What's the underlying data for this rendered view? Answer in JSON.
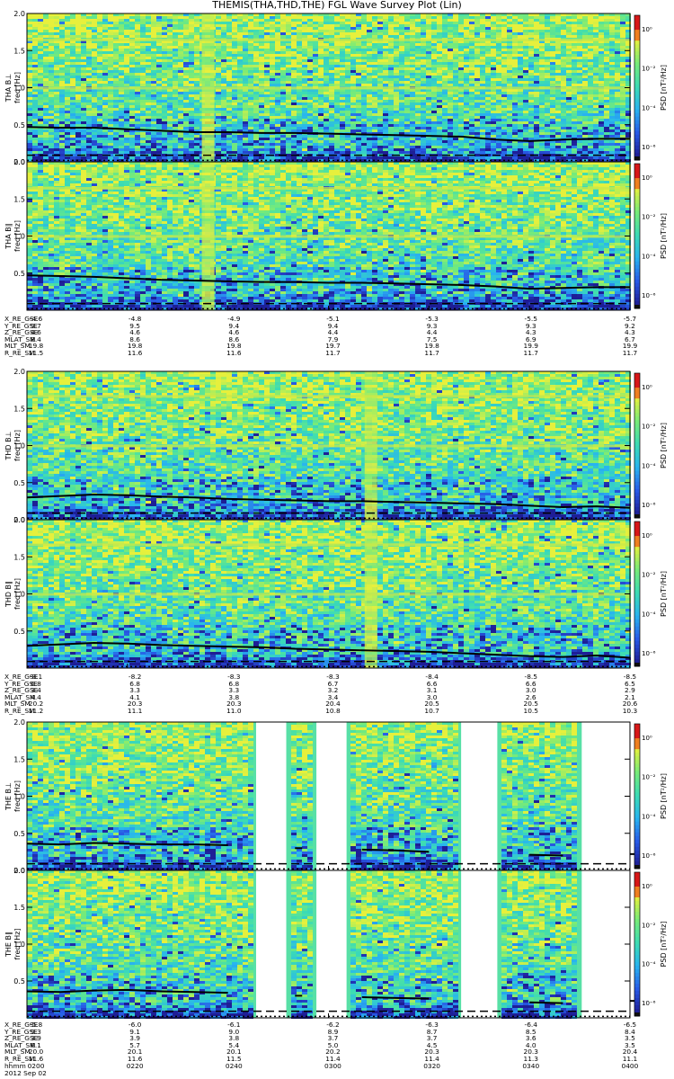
{
  "title": "THEMIS(THA,THD,THE) FGL Wave Survey Plot (Lin)",
  "date_label": "2012 Sep 02",
  "colors": {
    "background_spec": "#4fe0a0",
    "harmonic_line": "#c8e84a",
    "black_curve": "#000000"
  },
  "colorbar": {
    "label": "PSD [nT²/Hz]",
    "ticks": [
      "10⁰",
      "10⁻²",
      "10⁻⁴",
      "10⁻⁶"
    ]
  },
  "chart_data": [
    {
      "type": "heatmap",
      "probe": "THA",
      "panel": "B⊥",
      "ylabel_top": "THA B⊥",
      "ylabel": "freq [Hz]",
      "yticks": [
        "0.0",
        "0.5",
        "1.0",
        "1.5",
        "2.0"
      ],
      "ylim": [
        0,
        2.0
      ],
      "gaps": [],
      "bright_stripes": [
        0.29
      ],
      "harmonics": [
        1.0,
        1.65
      ],
      "curve": [
        0.47,
        0.46,
        0.46,
        0.44,
        0.42,
        0.4,
        0.4,
        0.39,
        0.39,
        0.38,
        0.37,
        0.36,
        0.35,
        0.34,
        0.3,
        0.28,
        0.3,
        0.31,
        0.31
      ]
    },
    {
      "type": "heatmap",
      "probe": "THA",
      "panel": "B∥",
      "ylabel_top": "THA B∥",
      "ylabel": "freq [Hz]",
      "yticks": [
        "0.5",
        "1.0",
        "1.5",
        "2.0"
      ],
      "ylim": [
        0,
        2.0
      ],
      "gaps": [],
      "bright_stripes": [
        0.29
      ],
      "harmonics": [
        1.0,
        1.65
      ],
      "curve": [
        0.47,
        0.46,
        0.45,
        0.43,
        0.41,
        0.4,
        0.39,
        0.38,
        0.38,
        0.37,
        0.37,
        0.36,
        0.35,
        0.34,
        0.32,
        0.29,
        0.3,
        0.31,
        0.31
      ]
    },
    {
      "type": "heatmap",
      "probe": "THD",
      "panel": "B⊥",
      "ylabel_top": "THD B⊥",
      "ylabel": "freq [Hz]",
      "yticks": [
        "0.0",
        "0.5",
        "1.0",
        "1.5",
        "2.0"
      ],
      "ylim": [
        0,
        2.0
      ],
      "gaps": [],
      "bright_stripes": [
        0.56
      ],
      "harmonics": [
        1.0,
        1.67
      ],
      "curve": [
        0.3,
        0.32,
        0.34,
        0.33,
        0.31,
        0.3,
        0.28,
        0.27,
        0.26,
        0.25,
        0.25,
        0.24,
        0.23,
        0.22,
        0.21,
        0.19,
        0.17,
        0.18,
        0.16
      ]
    },
    {
      "type": "heatmap",
      "probe": "THD",
      "panel": "B∥",
      "ylabel_top": "THD B∥",
      "ylabel": "freq [Hz]",
      "yticks": [
        "0.5",
        "1.0",
        "1.5",
        "2.0"
      ],
      "ylim": [
        0,
        2.0
      ],
      "gaps": [],
      "bright_stripes": [
        0.56
      ],
      "harmonics": [
        1.0,
        1.67
      ],
      "curve": [
        0.3,
        0.32,
        0.34,
        0.33,
        0.31,
        0.3,
        0.29,
        0.28,
        0.26,
        0.25,
        0.24,
        0.23,
        0.22,
        0.2,
        0.18,
        0.16,
        0.15,
        0.17,
        0.14
      ]
    },
    {
      "type": "heatmap",
      "probe": "THE",
      "panel": "B⊥",
      "ylabel_top": "THE B⊥",
      "ylabel": "freq [Hz]",
      "yticks": [
        "0.0",
        "0.5",
        "1.0",
        "1.5",
        "2.0"
      ],
      "ylim": [
        0,
        2.0
      ],
      "gaps": [
        [
          0.38,
          0.43
        ],
        [
          0.48,
          0.53
        ],
        [
          0.72,
          0.78
        ],
        [
          0.92,
          1.0
        ]
      ],
      "bright_stripes": [],
      "harmonics": [],
      "curve": [
        0.36,
        0.35,
        0.37,
        0.36,
        0.35,
        0.35,
        0.34,
        0.3,
        0.3,
        0.29,
        0.28,
        0.27,
        0.25,
        0.25,
        0.22,
        0.21,
        0.2,
        0.21,
        0.22
      ]
    },
    {
      "type": "heatmap",
      "probe": "THE",
      "panel": "B∥",
      "ylabel_top": "THE B∥",
      "ylabel": "freq [Hz]",
      "yticks": [
        "0.5",
        "1.0",
        "1.5",
        "2.0"
      ],
      "ylim": [
        0,
        2.0
      ],
      "gaps": [
        [
          0.38,
          0.43
        ],
        [
          0.48,
          0.53
        ],
        [
          0.72,
          0.78
        ],
        [
          0.92,
          1.0
        ]
      ],
      "bright_stripes": [],
      "harmonics": [],
      "curve": [
        0.36,
        0.35,
        0.37,
        0.38,
        0.36,
        0.35,
        0.34,
        0.3,
        0.3,
        0.29,
        0.28,
        0.27,
        0.26,
        0.26,
        0.22,
        0.21,
        0.2,
        0.22,
        0.23
      ]
    }
  ],
  "ephemeris": [
    {
      "labels": [
        "X_RE_GSE",
        "Y_RE_GSE",
        "Z_RE_GSE",
        "MLAT_SM",
        "MLT_SM",
        "R_RE_SM"
      ],
      "columns": [
        [
          "-4.6",
          "9.7",
          "4.6",
          "8.4",
          "19.8",
          "11.5"
        ],
        [
          "-4.8",
          "9.5",
          "4.6",
          "8.6",
          "19.8",
          "11.6"
        ],
        [
          "-4.9",
          "9.4",
          "4.6",
          "8.6",
          "19.8",
          "11.6"
        ],
        [
          "-5.1",
          "9.4",
          "4.4",
          "7.9",
          "19.7",
          "11.7"
        ],
        [
          "-5.3",
          "9.3",
          "4.4",
          "7.5",
          "19.8",
          "11.7"
        ],
        [
          "-5.5",
          "9.3",
          "4.3",
          "6.9",
          "19.9",
          "11.7"
        ],
        [
          "-5.7",
          "9.2",
          "4.3",
          "6.7",
          "19.9",
          "11.7"
        ]
      ]
    },
    {
      "labels": [
        "X_RE_GSE",
        "Y_RE_GSE",
        "Z_RE_GSE",
        "MLAT_SM",
        "MLT_SM",
        "R_RE_SM"
      ],
      "columns": [
        [
          "-8.1",
          "6.8",
          "3.4",
          "4.4",
          "20.2",
          "11.2"
        ],
        [
          "-8.2",
          "6.8",
          "3.3",
          "4.1",
          "20.3",
          "11.1"
        ],
        [
          "-8.3",
          "6.8",
          "3.3",
          "3.8",
          "20.3",
          "11.0"
        ],
        [
          "-8.3",
          "6.7",
          "3.2",
          "3.4",
          "20.4",
          "10.8"
        ],
        [
          "-8.4",
          "6.6",
          "3.1",
          "3.0",
          "20.5",
          "10.7"
        ],
        [
          "-8.5",
          "6.6",
          "3.0",
          "2.6",
          "20.5",
          "10.5"
        ],
        [
          "-8.5",
          "6.5",
          "2.9",
          "2.1",
          "20.6",
          "10.3"
        ]
      ]
    },
    {
      "labels": [
        "X_RE_GSE",
        "Y_RE_GSE",
        "Z_RE_GSE",
        "MLAT_SM",
        "MLT_SM",
        "R_RE_SM",
        "hhmm"
      ],
      "columns": [
        [
          "-5.8",
          "9.3",
          "3.9",
          "6.1",
          "20.0",
          "11.6",
          "0200"
        ],
        [
          "-6.0",
          "9.1",
          "3.9",
          "5.7",
          "20.1",
          "11.6",
          "0220"
        ],
        [
          "-6.1",
          "9.0",
          "3.8",
          "5.4",
          "20.1",
          "11.5",
          "0240"
        ],
        [
          "-6.2",
          "8.9",
          "3.7",
          "5.0",
          "20.2",
          "11.4",
          "0300"
        ],
        [
          "-6.3",
          "8.7",
          "3.7",
          "4.5",
          "20.3",
          "11.4",
          "0320"
        ],
        [
          "-6.4",
          "8.5",
          "3.6",
          "4.0",
          "20.3",
          "11.3",
          "0340"
        ],
        [
          "-6.5",
          "8.4",
          "3.5",
          "3.5",
          "20.4",
          "11.1",
          "0400"
        ]
      ]
    }
  ]
}
